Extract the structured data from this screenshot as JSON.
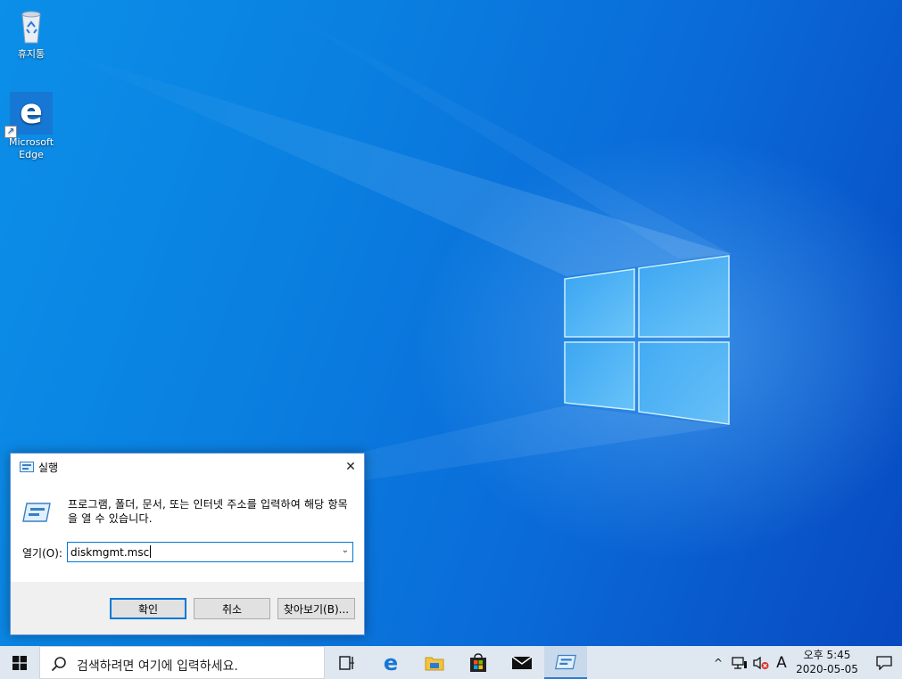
{
  "desktop": {
    "icons": [
      {
        "label": "휴지통",
        "icon": "recycle-bin-icon"
      },
      {
        "label": "Microsoft Edge",
        "icon": "edge-icon"
      }
    ]
  },
  "run_dialog": {
    "title": "실행",
    "close_label": "✕",
    "description": "프로그램, 폴더, 문서, 또는 인터넷 주소를 입력하여 해당 항목을 열 수 있습니다.",
    "open_label": "열기(O):",
    "command_value": "diskmgmt.msc",
    "buttons": {
      "ok": "확인",
      "cancel": "취소",
      "browse": "찾아보기(B)..."
    }
  },
  "taskbar": {
    "search_placeholder": "검색하려면 여기에 입력하세요.",
    "pinned": [
      {
        "icon": "task-view-icon"
      },
      {
        "icon": "edge-icon"
      },
      {
        "icon": "file-explorer-icon"
      },
      {
        "icon": "store-icon"
      },
      {
        "icon": "mail-icon"
      },
      {
        "icon": "run-icon",
        "active": true
      }
    ],
    "tray": {
      "chevron": "^",
      "ime_label": "A"
    },
    "clock": {
      "time": "오후 5:45",
      "date": "2020-05-05"
    }
  },
  "colors": {
    "accent": "#0078d7",
    "taskbar": "#dfe7f1",
    "desktop": "#0a7fe0"
  }
}
